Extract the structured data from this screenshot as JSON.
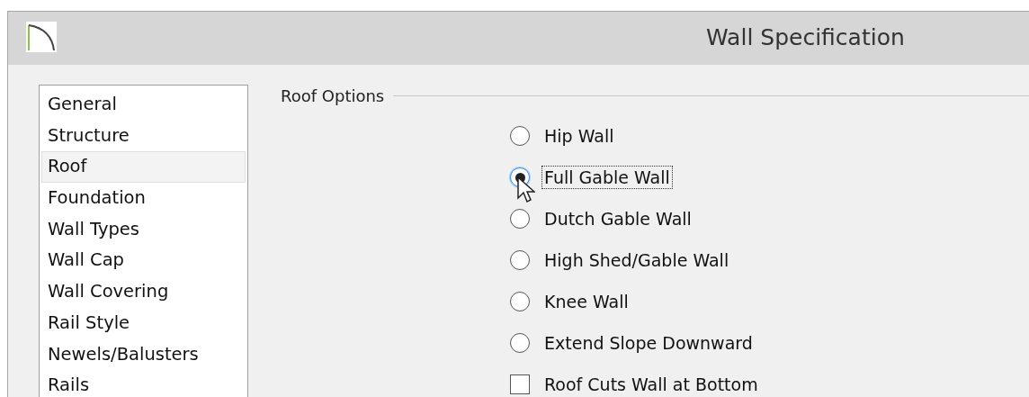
{
  "window": {
    "title": "Wall Specification"
  },
  "sidebar": {
    "items": [
      {
        "label": "General",
        "selected": false
      },
      {
        "label": "Structure",
        "selected": false
      },
      {
        "label": "Roof",
        "selected": true
      },
      {
        "label": "Foundation",
        "selected": false
      },
      {
        "label": "Wall Types",
        "selected": false
      },
      {
        "label": "Wall Cap",
        "selected": false
      },
      {
        "label": "Wall Covering",
        "selected": false
      },
      {
        "label": "Rail Style",
        "selected": false
      },
      {
        "label": "Newels/Balusters",
        "selected": false
      },
      {
        "label": "Rails",
        "selected": false
      }
    ]
  },
  "roof_options": {
    "title": "Roof Options",
    "options": [
      {
        "kind": "radio",
        "label": "Hip Wall",
        "selected": false,
        "focused": false
      },
      {
        "kind": "radio",
        "label": "Full Gable Wall",
        "selected": true,
        "focused": true
      },
      {
        "kind": "radio",
        "label": "Dutch Gable Wall",
        "selected": false,
        "focused": false
      },
      {
        "kind": "radio",
        "label": "High Shed/Gable Wall",
        "selected": false,
        "focused": false
      },
      {
        "kind": "radio",
        "label": "Knee Wall",
        "selected": false,
        "focused": false
      },
      {
        "kind": "radio",
        "label": "Extend Slope Downward",
        "selected": false,
        "focused": false
      },
      {
        "kind": "checkbox",
        "label": "Roof Cuts Wall at Bottom",
        "checked": false,
        "focused": false
      }
    ]
  }
}
